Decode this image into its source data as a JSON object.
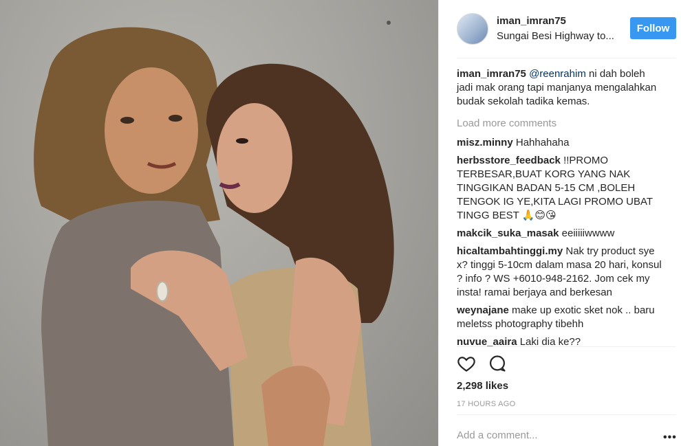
{
  "post": {
    "owner": "iman_imran75",
    "location": "Sungai Besi Highway to...",
    "follow_label": "Follow"
  },
  "caption": {
    "user": "iman_imran75",
    "mention": "@reenrahim",
    "text": " ni dah boleh jadi mak orang tapi manjanya mengalahkan budak sekolah tadika kemas."
  },
  "load_more": "Load more comments",
  "comments": [
    {
      "user": "misz.minny",
      "text": " Hahhahaha"
    },
    {
      "user": "herbsstore_feedback",
      "text": " !!PROMO TERBESAR,BUAT KORG YANG NAK TINGGIKAN BADAN 5-15 CM ,BOLEH TENGOK IG YE,KITA LAGI PROMO UBAT TINGG BEST 🙏😊😘"
    },
    {
      "user": "makcik_suka_masak",
      "text": " eeiiiiiwwww"
    },
    {
      "user": "hicaltambahtinggi.my",
      "text": " Nak try product sye x? tinggi 5-10cm dalam masa 20 hari, konsul ? info ? WS +6010-948-2162. Jom cek my insta! ramai berjaya and berkesan"
    },
    {
      "user": "weynajane",
      "text": " make up exotic sket nok .. baru meletss photography tibehh"
    },
    {
      "user": "nuvue_aaira",
      "text": " Laki dia ke??"
    }
  ],
  "likes": "2,298 likes",
  "time": "17 HOURS AGO",
  "add_comment_placeholder": "Add a comment...",
  "more_label": "•••",
  "icons": {
    "like": "heart-icon",
    "comment": "comment-bubble-icon",
    "more": "more-options-icon"
  }
}
